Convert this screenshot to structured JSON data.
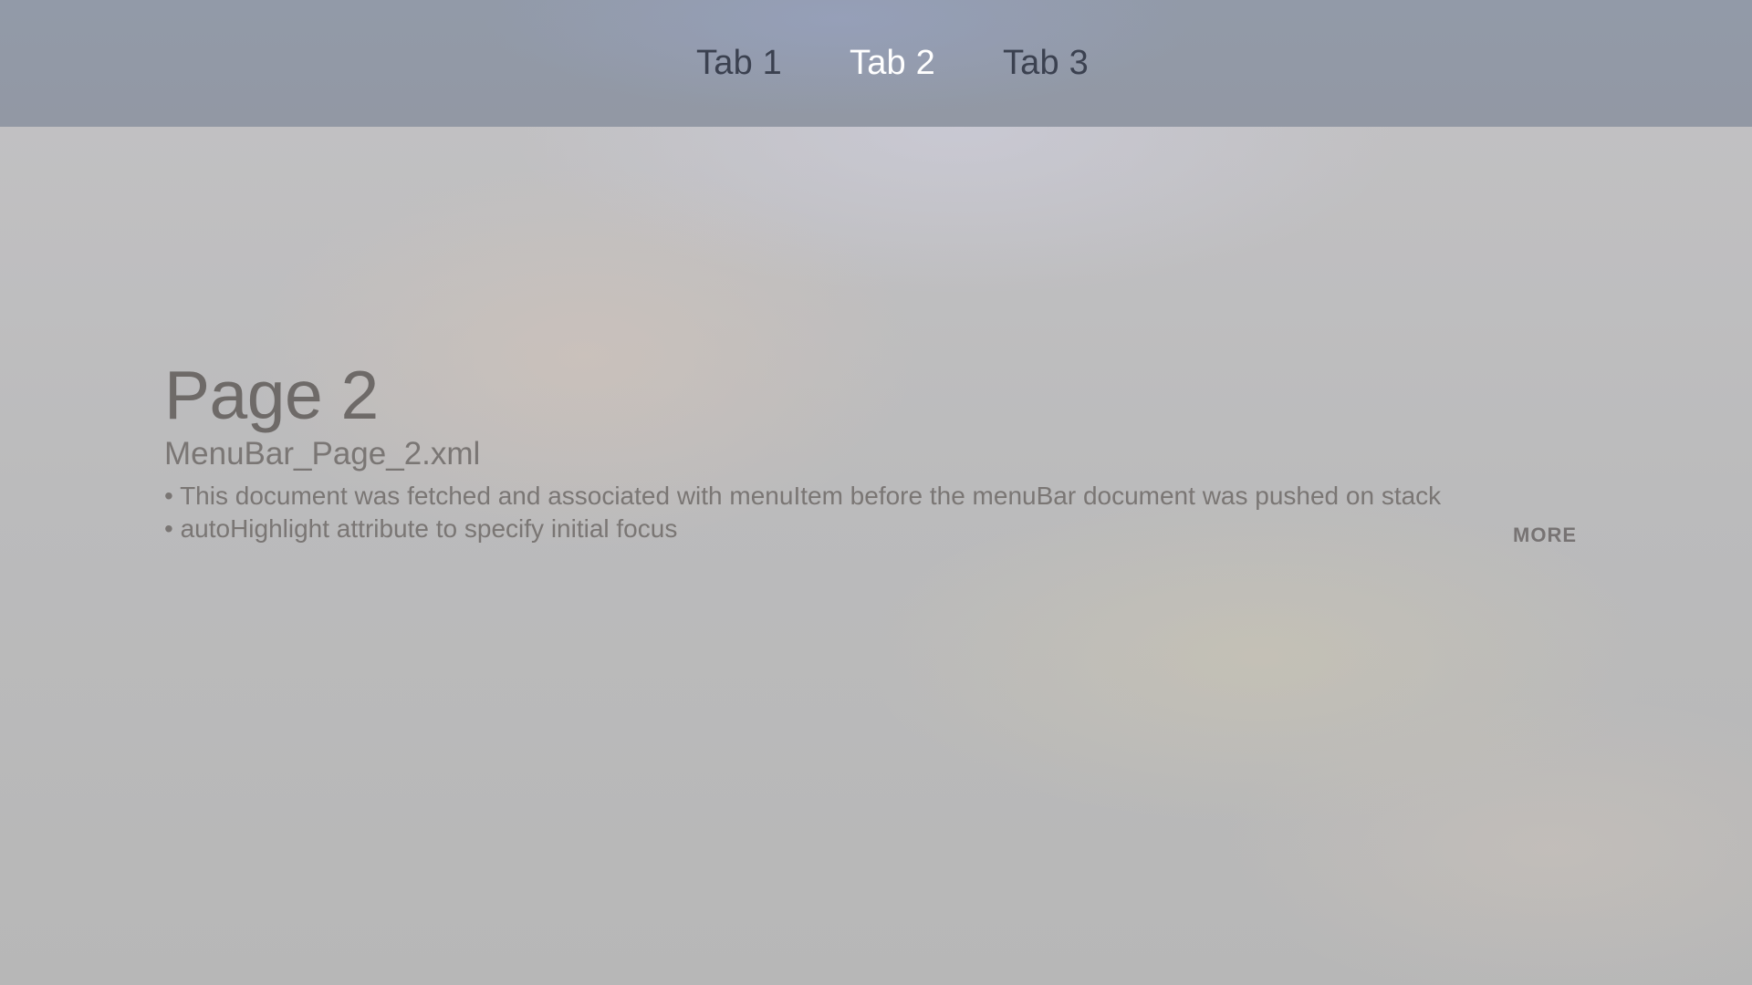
{
  "menu_bar": {
    "tabs": [
      {
        "label": "Tab 1",
        "active": false
      },
      {
        "label": "Tab 2",
        "active": true
      },
      {
        "label": "Tab 3",
        "active": false
      }
    ]
  },
  "page": {
    "title": "Page 2",
    "subtitle": "MenuBar_Page_2.xml",
    "description_lines": [
      "• This document was fetched and associated with menuItem before the menuBar document was pushed on stack",
      "• autoHighlight attribute to specify initial focus"
    ],
    "more_label": "MORE"
  },
  "colors": {
    "active_tab": "#ffffff",
    "inactive_tab": "#3b4150",
    "menu_bar_background": "#929aa8",
    "title_text": "#6e6a68"
  }
}
